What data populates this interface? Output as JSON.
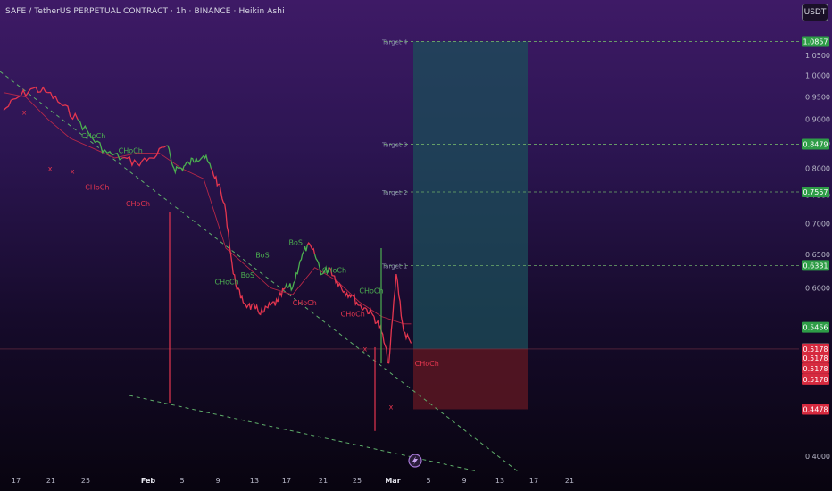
{
  "header": {
    "title": "SAFE / TetherUS PERPETUAL CONTRACT · 1h · BINANCE · Heikin Ashi"
  },
  "currency_button": {
    "label": "USDT"
  },
  "colors": {
    "up": "#4caf50",
    "down": "#e5364f",
    "target_line": "#6fae6a",
    "trendline": "#5fae6a",
    "badge_green": "#2e9d47",
    "badge_red": "#d62a3f",
    "badge_gray": "#555a66",
    "profit_zone": "#1c4d5a",
    "loss_zone": "#5a1622"
  },
  "chart_data": {
    "type": "line",
    "title": "SAFE / TetherUS PERPETUAL CONTRACT · 1h · BINANCE · Heikin Ashi",
    "y_axis": {
      "ticks": [
        "1.0500",
        "1.0000",
        "0.9500",
        "0.9000",
        "0.8500",
        "0.8000",
        "0.7500",
        "0.7000",
        "0.6500",
        "0.6000",
        "0.4000"
      ],
      "tick_values": [
        1.05,
        1.0,
        0.95,
        0.9,
        0.85,
        0.8,
        0.75,
        0.7,
        0.65,
        0.6,
        0.4
      ],
      "range": [
        0.36,
        1.12
      ]
    },
    "x_axis": {
      "ticks": [
        "17",
        "21",
        "25",
        "Feb",
        "5",
        "9",
        "13",
        "17",
        "21",
        "25",
        "Mar",
        "5",
        "9",
        "13",
        "17",
        "21"
      ],
      "bold": [
        "Feb",
        "Mar"
      ]
    },
    "price_series": {
      "name": "",
      "x": [
        0,
        2,
        4,
        6,
        8,
        10,
        12,
        14,
        16,
        18,
        20,
        22,
        23,
        24,
        25,
        26,
        27,
        28,
        29,
        30,
        31,
        32,
        33,
        34,
        35,
        36,
        37,
        38,
        39,
        40,
        41,
        42,
        43,
        44,
        45,
        46,
        47,
        48,
        49,
        50,
        51,
        52,
        53,
        54,
        55
      ],
      "y": [
        0.92,
        0.95,
        0.97,
        0.96,
        0.93,
        0.9,
        0.86,
        0.83,
        0.82,
        0.81,
        0.82,
        0.845,
        0.8,
        0.8,
        0.81,
        0.82,
        0.825,
        0.8,
        0.77,
        0.72,
        0.62,
        0.585,
        0.575,
        0.57,
        0.565,
        0.575,
        0.58,
        0.6,
        0.6,
        0.64,
        0.665,
        0.65,
        0.62,
        0.63,
        0.61,
        0.595,
        0.59,
        0.575,
        0.57,
        0.56,
        0.54,
        0.5,
        0.62,
        0.54,
        0.525
      ],
      "up_segments": [
        [
          10,
          14
        ],
        [
          22,
          27
        ],
        [
          38,
          40
        ],
        [
          42,
          43
        ]
      ]
    },
    "channel_line": {
      "name": "",
      "x": [
        0,
        3,
        6,
        9,
        12,
        15,
        18,
        21,
        24,
        27,
        30,
        33,
        36,
        39,
        42,
        45,
        48,
        51,
        54,
        55
      ],
      "y": [
        0.96,
        0.95,
        0.9,
        0.86,
        0.84,
        0.82,
        0.83,
        0.83,
        0.8,
        0.78,
        0.66,
        0.63,
        0.6,
        0.59,
        0.63,
        0.61,
        0.58,
        0.56,
        0.55,
        0.55
      ]
    },
    "annotations": [
      {
        "text": "CHoCh",
        "color": "up",
        "x": 10.5,
        "y": 0.86
      },
      {
        "text": "CHoCh",
        "color": "up",
        "x": 15.5,
        "y": 0.83
      },
      {
        "text": "CHoCh",
        "color": "down",
        "x": 11,
        "y": 0.76
      },
      {
        "text": "CHoCh",
        "color": "down",
        "x": 16.5,
        "y": 0.73
      },
      {
        "text": "x",
        "color": "down",
        "x": 6,
        "y": 0.795
      },
      {
        "text": "x",
        "color": "down",
        "x": 9,
        "y": 0.79
      },
      {
        "text": "x",
        "color": "down",
        "x": 2.5,
        "y": 0.91
      },
      {
        "text": "CHoCh",
        "color": "up",
        "x": 28.5,
        "y": 0.605
      },
      {
        "text": "BoS",
        "color": "up",
        "x": 32,
        "y": 0.615
      },
      {
        "text": "BoS",
        "color": "up",
        "x": 34,
        "y": 0.645
      },
      {
        "text": "BoS",
        "color": "up",
        "x": 38.5,
        "y": 0.665
      },
      {
        "text": "CHoCh",
        "color": "up",
        "x": 43,
        "y": 0.622
      },
      {
        "text": "CHoCh",
        "color": "up",
        "x": 48,
        "y": 0.592
      },
      {
        "text": "CHoCh",
        "color": "down",
        "x": 39,
        "y": 0.575
      },
      {
        "text": "CHoCh",
        "color": "down",
        "x": 45.5,
        "y": 0.56
      },
      {
        "text": "x",
        "color": "down",
        "x": 48.5,
        "y": 0.515
      },
      {
        "text": "x",
        "color": "down",
        "x": 52,
        "y": 0.448
      },
      {
        "text": "CHoCh",
        "color": "down",
        "x": 55.5,
        "y": 0.497
      }
    ],
    "targets": [
      {
        "label": "Target 4",
        "value": 1.0857,
        "badge": "1.0857"
      },
      {
        "label": "Target 3",
        "value": 0.8479,
        "badge": "0.8479"
      },
      {
        "label": "Target 2",
        "value": 0.7557,
        "badge": "0.7557"
      },
      {
        "label": "Target 1",
        "value": 0.6331,
        "badge": "0.6331"
      }
    ],
    "price_badges": [
      {
        "value": 0.5456,
        "badge": "0.5456",
        "color": "badge_green"
      },
      {
        "value": 0.5186,
        "badge": "0.5186",
        "color": "badge_gray"
      },
      {
        "value": 0.5178,
        "badge": "0.5178",
        "color": "badge_red"
      },
      {
        "value": 0.4478,
        "badge": "0.4478",
        "color": "badge_red"
      }
    ],
    "position": {
      "entry": 0.5178,
      "stop": 0.4478,
      "target": 1.0857
    },
    "grid": false,
    "legend": "none"
  },
  "trend_labels": {
    "red_stack": [
      "0.5178",
      "0.5178",
      "0.5178"
    ]
  }
}
